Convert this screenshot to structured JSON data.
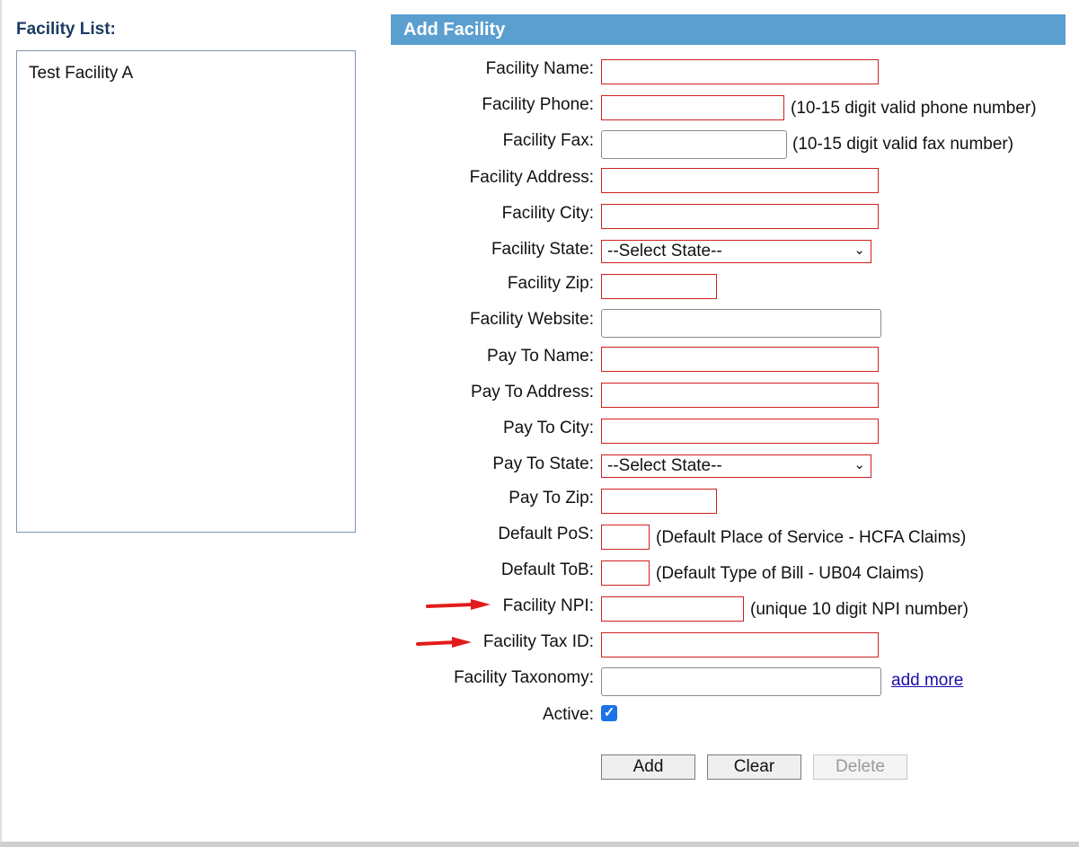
{
  "left_panel": {
    "title": "Facility List:",
    "items": [
      "Test Facility A"
    ]
  },
  "form": {
    "header": "Add Facility",
    "labels": {
      "facility_name": "Facility Name:",
      "facility_phone": "Facility Phone:",
      "facility_fax": "Facility Fax:",
      "facility_address": "Facility Address:",
      "facility_city": "Facility City:",
      "facility_state": "Facility State:",
      "facility_zip": "Facility Zip:",
      "facility_website": "Facility Website:",
      "pay_to_name": "Pay To Name:",
      "pay_to_address": "Pay To Address:",
      "pay_to_city": "Pay To City:",
      "pay_to_state": "Pay To State:",
      "pay_to_zip": "Pay To Zip:",
      "default_pos": "Default PoS:",
      "default_tob": "Default ToB:",
      "facility_npi": "Facility NPI:",
      "facility_tax_id": "Facility Tax ID:",
      "facility_taxonomy": "Facility Taxonomy:",
      "active": "Active:"
    },
    "hints": {
      "phone": "(10-15 digit valid phone number)",
      "fax": "(10-15 digit valid fax number)",
      "pos": "(Default Place of Service - HCFA Claims)",
      "tob": "(Default Type of Bill - UB04 Claims)",
      "npi": "(unique 10 digit NPI number)"
    },
    "state_select_value": "--Select State--",
    "add_more_link": "add more",
    "active_checked": true,
    "buttons": {
      "add": "Add",
      "clear": "Clear",
      "delete": "Delete"
    }
  },
  "colors": {
    "header_bg": "#5a9fd0",
    "required_border": "#d02020",
    "annotation_arrow": "#e31b1b",
    "list_title": "#1c3b62"
  },
  "icons": {
    "select_chevron": "chevron-down-icon",
    "checkbox": "checkmark-icon",
    "annotation": "red-arrow-icon"
  }
}
